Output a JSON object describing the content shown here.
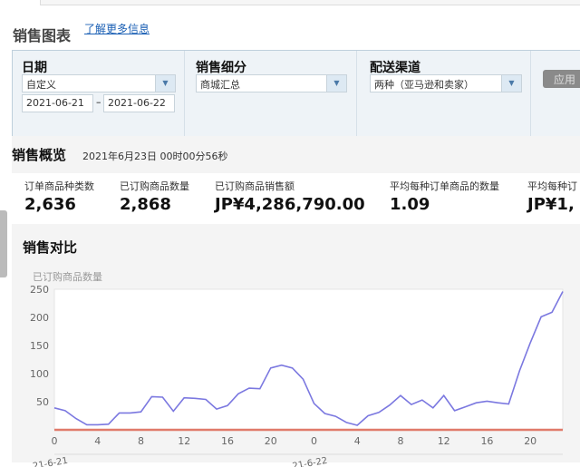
{
  "header": {
    "title": "销售图表",
    "more_link": "了解更多信息"
  },
  "filters": {
    "date": {
      "label": "日期",
      "value": "自定义",
      "start": "2021-06-21",
      "sep": "–",
      "end": "2021-06-22"
    },
    "segment": {
      "label": "销售细分",
      "value": "商城汇总"
    },
    "channel": {
      "label": "配送渠道",
      "value": "两种（亚马逊和卖家）"
    },
    "apply_label": "应用"
  },
  "overview": {
    "title": "销售概览",
    "timestamp": "2021年6月23日 00时00分56秒",
    "stats": [
      {
        "label": "订单商品种类数",
        "value": "2,636"
      },
      {
        "label": "已订购商品数量",
        "value": "2,868"
      },
      {
        "label": "已订购商品销售额",
        "value": "JP¥4,286,790.00"
      },
      {
        "label": "平均每种订单商品的数量",
        "value": "1.09"
      },
      {
        "label": "平均每种订",
        "value": "JP¥1,"
      }
    ]
  },
  "comparison": {
    "title": "销售对比"
  },
  "chart_data": {
    "type": "line",
    "ylabel": "已订购商品数量",
    "ylim": [
      0,
      250
    ],
    "yticks": [
      "50",
      "100",
      "150",
      "200",
      "250"
    ],
    "xticks": [
      "0",
      "4",
      "8",
      "12",
      "16",
      "20",
      "0",
      "4",
      "8",
      "12",
      "16",
      "20"
    ],
    "date_labels": [
      "21-6-21",
      "21-6-22"
    ],
    "grid": false,
    "series": [
      {
        "color": "#7b78e0",
        "values": [
          39,
          34,
          20,
          9,
          9,
          10,
          30,
          30,
          32,
          59,
          58,
          33,
          57,
          56,
          54,
          37,
          43,
          64,
          74,
          73,
          110,
          115,
          110,
          90,
          47,
          29,
          24,
          13,
          8,
          25,
          31,
          44,
          61,
          45,
          53,
          39,
          61,
          34,
          41,
          48,
          51,
          48,
          46,
          105,
          155,
          201,
          209,
          246
        ]
      },
      {
        "color": "#e07a6a",
        "values": [
          0,
          0,
          0,
          0,
          0,
          0,
          0,
          0,
          0,
          0,
          0,
          0,
          0,
          0,
          0,
          0,
          0,
          0,
          0,
          0,
          0,
          0,
          0,
          0,
          0,
          0,
          0,
          0,
          0,
          0,
          0,
          0,
          0,
          0,
          0,
          0,
          0,
          0,
          0,
          0,
          0,
          0,
          0,
          0,
          0,
          0,
          0,
          0
        ]
      }
    ]
  }
}
